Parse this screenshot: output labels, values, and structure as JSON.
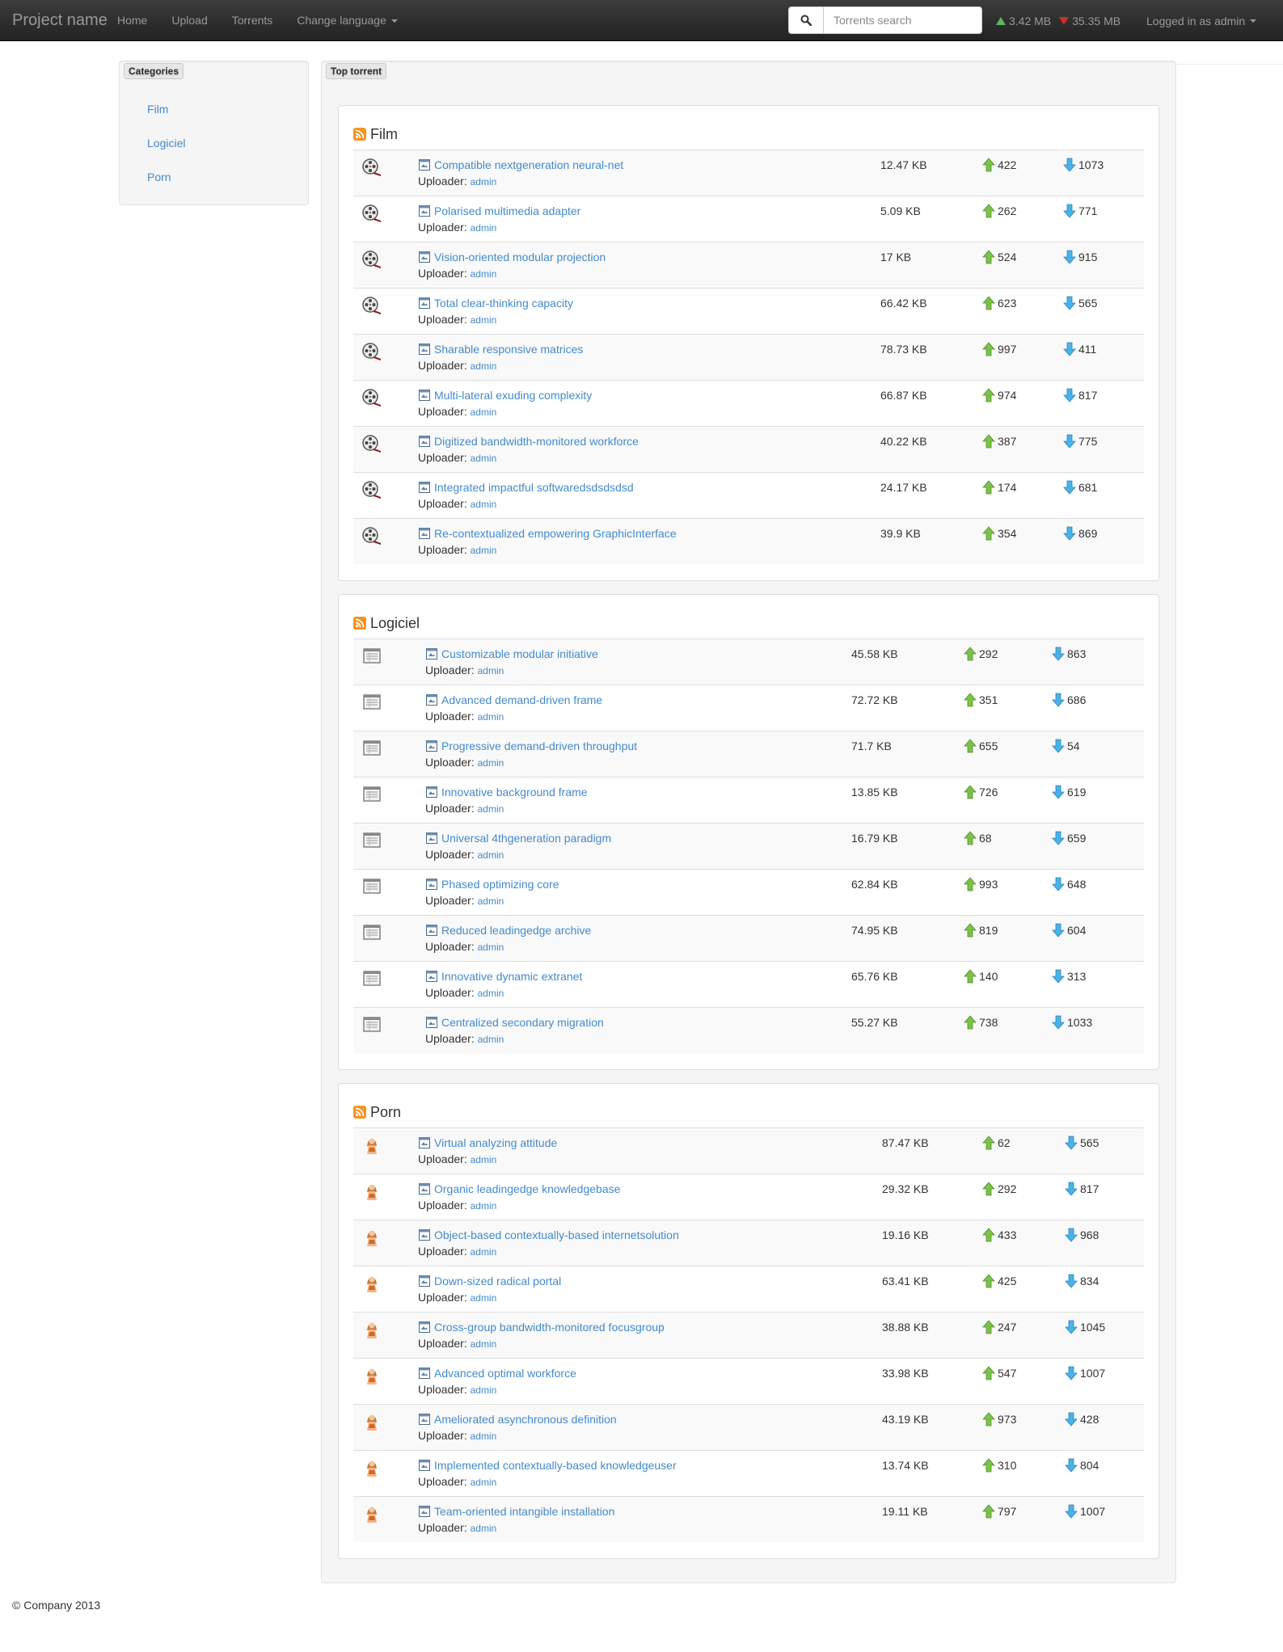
{
  "navbar": {
    "brand": "Project name",
    "links": [
      "Home",
      "Upload",
      "Torrents",
      "Change language"
    ],
    "search_placeholder": "Torrents search",
    "upload_stat": "3.42 MB",
    "download_stat": "35.35 MB",
    "user": "Logged in as admin"
  },
  "sidebar": {
    "title": "Categories",
    "items": [
      "Film",
      "Logiciel",
      "Porn"
    ]
  },
  "main": {
    "title": "Top torrent",
    "uploader_label": "Uploader:",
    "categories": [
      {
        "name": "Film",
        "icon": "film-reel-icon",
        "torrents": [
          {
            "name": "Compatible nextgeneration neural-net",
            "uploader": "admin",
            "size": "12.47 KB",
            "seeders": "422",
            "leechers": "1073"
          },
          {
            "name": "Polarised multimedia adapter",
            "uploader": "admin",
            "size": "5.09 KB",
            "seeders": "262",
            "leechers": "771"
          },
          {
            "name": "Vision-oriented modular projection",
            "uploader": "admin",
            "size": "17 KB",
            "seeders": "524",
            "leechers": "915"
          },
          {
            "name": "Total clear-thinking capacity",
            "uploader": "admin",
            "size": "66.42 KB",
            "seeders": "623",
            "leechers": "565"
          },
          {
            "name": "Sharable responsive matrices",
            "uploader": "admin",
            "size": "78.73 KB",
            "seeders": "997",
            "leechers": "411"
          },
          {
            "name": "Multi-lateral exuding complexity",
            "uploader": "admin",
            "size": "66.87 KB",
            "seeders": "974",
            "leechers": "817"
          },
          {
            "name": "Digitized bandwidth-monitored workforce",
            "uploader": "admin",
            "size": "40.22 KB",
            "seeders": "387",
            "leechers": "775"
          },
          {
            "name": "Integrated impactful softwaredsdsdsdsd",
            "uploader": "admin",
            "size": "24.17 KB",
            "seeders": "174",
            "leechers": "681"
          },
          {
            "name": "Re-contextualized empowering GraphicInterface",
            "uploader": "admin",
            "size": "39.9 KB",
            "seeders": "354",
            "leechers": "869"
          }
        ]
      },
      {
        "name": "Logiciel",
        "icon": "software-window-icon",
        "torrents": [
          {
            "name": "Customizable modular initiative",
            "uploader": "admin",
            "size": "45.58 KB",
            "seeders": "292",
            "leechers": "863"
          },
          {
            "name": "Advanced demand-driven frame",
            "uploader": "admin",
            "size": "72.72 KB",
            "seeders": "351",
            "leechers": "686"
          },
          {
            "name": "Progressive demand-driven throughput",
            "uploader": "admin",
            "size": "71.7 KB",
            "seeders": "655",
            "leechers": "54"
          },
          {
            "name": "Innovative background frame",
            "uploader": "admin",
            "size": "13.85 KB",
            "seeders": "726",
            "leechers": "619"
          },
          {
            "name": "Universal 4thgeneration paradigm",
            "uploader": "admin",
            "size": "16.79 KB",
            "seeders": "68",
            "leechers": "659"
          },
          {
            "name": "Phased optimizing core",
            "uploader": "admin",
            "size": "62.84 KB",
            "seeders": "993",
            "leechers": "648"
          },
          {
            "name": "Reduced leadingedge archive",
            "uploader": "admin",
            "size": "74.95 KB",
            "seeders": "819",
            "leechers": "604"
          },
          {
            "name": "Innovative dynamic extranet",
            "uploader": "admin",
            "size": "65.76 KB",
            "seeders": "140",
            "leechers": "313"
          },
          {
            "name": "Centralized secondary migration",
            "uploader": "admin",
            "size": "55.27 KB",
            "seeders": "738",
            "leechers": "1033"
          }
        ]
      },
      {
        "name": "Porn",
        "icon": "person-figure-icon",
        "torrents": [
          {
            "name": "Virtual analyzing attitude",
            "uploader": "admin",
            "size": "87.47 KB",
            "seeders": "62",
            "leechers": "565"
          },
          {
            "name": "Organic leadingedge knowledgebase",
            "uploader": "admin",
            "size": "29.32 KB",
            "seeders": "292",
            "leechers": "817"
          },
          {
            "name": "Object-based contextually-based internetsolution",
            "uploader": "admin",
            "size": "19.16 KB",
            "seeders": "433",
            "leechers": "968"
          },
          {
            "name": "Down-sized radical portal",
            "uploader": "admin",
            "size": "63.41 KB",
            "seeders": "425",
            "leechers": "834"
          },
          {
            "name": "Cross-group bandwidth-monitored focusgroup",
            "uploader": "admin",
            "size": "38.88 KB",
            "seeders": "247",
            "leechers": "1045"
          },
          {
            "name": "Advanced optimal workforce",
            "uploader": "admin",
            "size": "33.98 KB",
            "seeders": "547",
            "leechers": "1007"
          },
          {
            "name": "Ameliorated asynchronous definition",
            "uploader": "admin",
            "size": "43.19 KB",
            "seeders": "973",
            "leechers": "428"
          },
          {
            "name": "Implemented contextually-based knowledgeuser",
            "uploader": "admin",
            "size": "13.74 KB",
            "seeders": "310",
            "leechers": "804"
          },
          {
            "name": "Team-oriented intangible installation",
            "uploader": "admin",
            "size": "19.11 KB",
            "seeders": "797",
            "leechers": "1007"
          }
        ]
      }
    ]
  },
  "footer": {
    "text": "© Company 2013"
  },
  "colors": {
    "link": "#428bca",
    "seed_arrow": "#7cc24a",
    "leech_arrow": "#49b3e8",
    "navbar": "#222222"
  }
}
